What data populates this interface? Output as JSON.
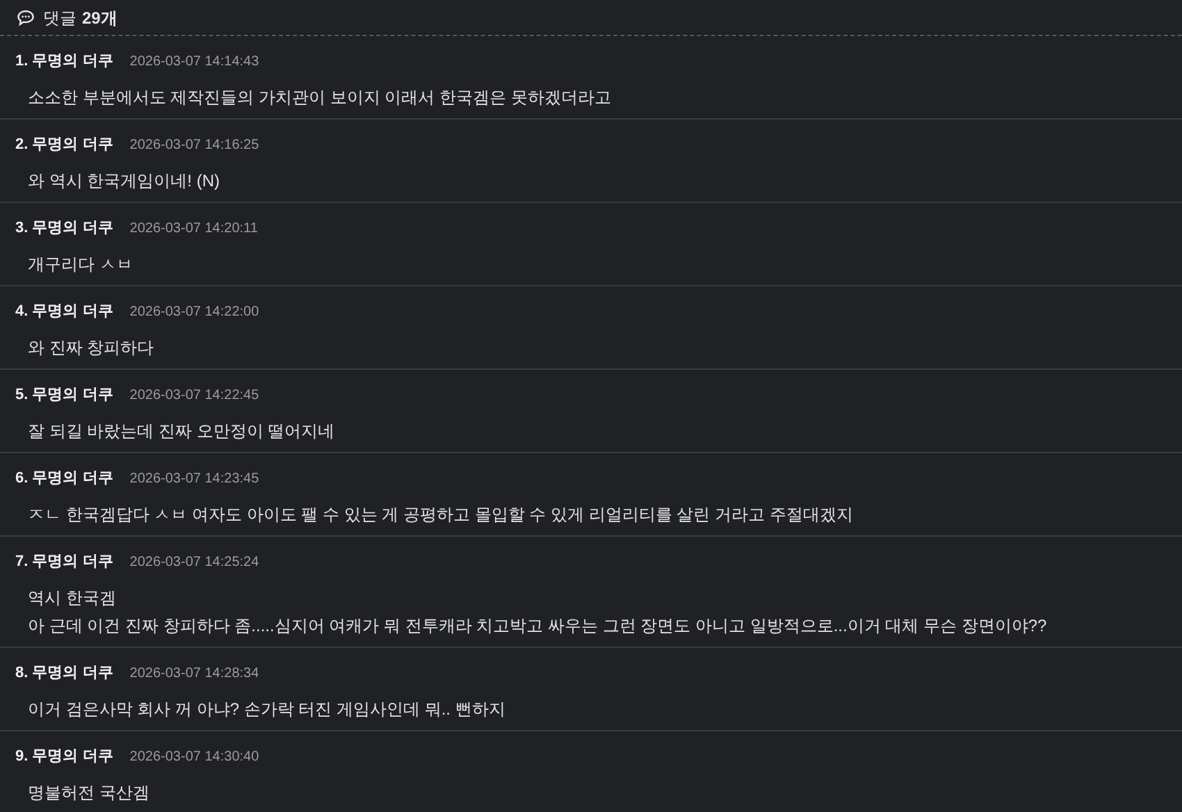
{
  "header": {
    "label": "댓글",
    "count": "29개"
  },
  "comments": [
    {
      "number": "1.",
      "author": "무명의 더쿠",
      "time": "2026-03-07 14:14:43",
      "lines": [
        "소소한 부분에서도 제작진들의 가치관이 보이지 이래서 한국겜은 못하겠더라고"
      ]
    },
    {
      "number": "2.",
      "author": "무명의 더쿠",
      "time": "2026-03-07 14:16:25",
      "lines": [
        "와 역시 한국게임이네! (N)"
      ]
    },
    {
      "number": "3.",
      "author": "무명의 더쿠",
      "time": "2026-03-07 14:20:11",
      "lines": [
        "개구리다 ㅅㅂ"
      ]
    },
    {
      "number": "4.",
      "author": "무명의 더쿠",
      "time": "2026-03-07 14:22:00",
      "lines": [
        "와 진짜 창피하다"
      ]
    },
    {
      "number": "5.",
      "author": "무명의 더쿠",
      "time": "2026-03-07 14:22:45",
      "lines": [
        "잘 되길 바랐는데 진짜 오만정이 떨어지네"
      ]
    },
    {
      "number": "6.",
      "author": "무명의 더쿠",
      "time": "2026-03-07 14:23:45",
      "lines": [
        "ㅈㄴ 한국겜답다 ㅅㅂ 여자도 아이도 팰 수 있는 게 공평하고 몰입할 수 있게 리얼리티를 살린 거라고 주절대겠지"
      ]
    },
    {
      "number": "7.",
      "author": "무명의 더쿠",
      "time": "2026-03-07 14:25:24",
      "lines": [
        "역시 한국겜",
        "아 근데 이건 진짜 창피하다 좀.....심지어 여캐가 뭐 전투캐라 치고박고 싸우는 그런 장면도 아니고 일방적으로...이거 대체 무슨 장면이야??"
      ]
    },
    {
      "number": "8.",
      "author": "무명의 더쿠",
      "time": "2026-03-07 14:28:34",
      "lines": [
        "이거 검은사막 회사 꺼 아냐? 손가락 터진 게임사인데 뭐.. 뻔하지"
      ]
    },
    {
      "number": "9.",
      "author": "무명의 더쿠",
      "time": "2026-03-07 14:30:40",
      "lines": [
        "명불허전 국산겜"
      ]
    }
  ]
}
